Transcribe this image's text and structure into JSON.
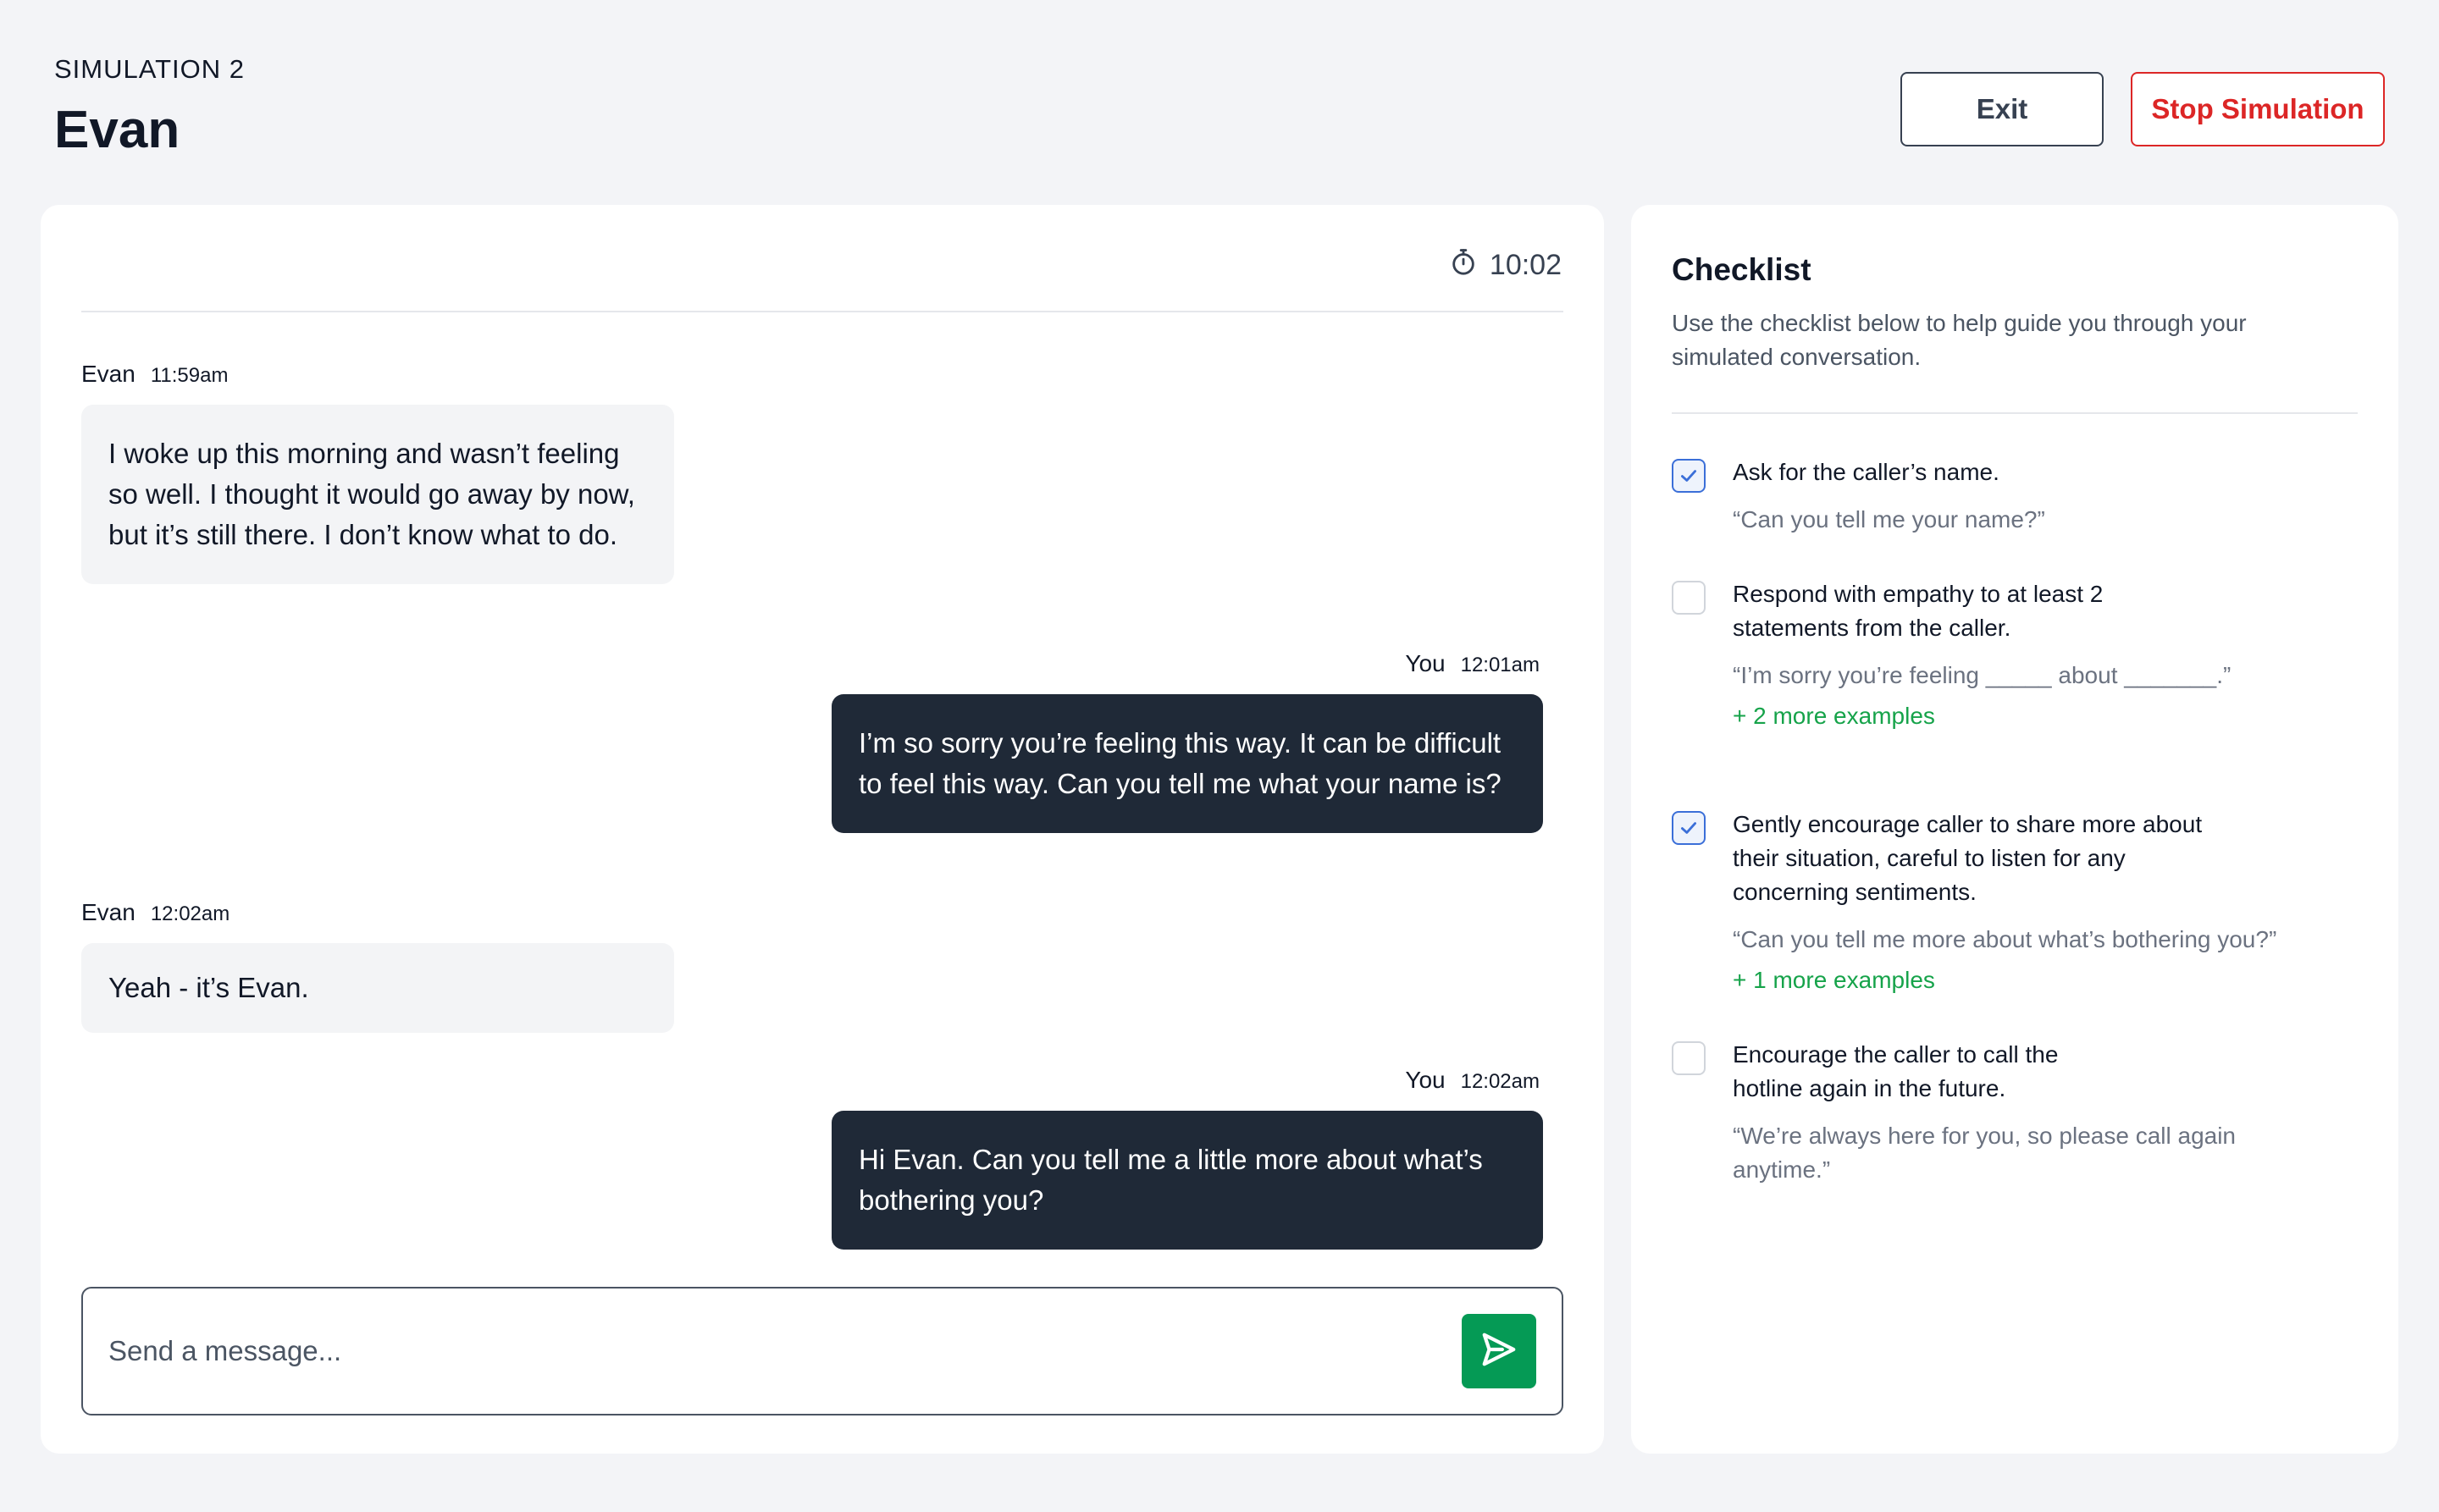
{
  "header": {
    "simulation_label": "SIMULATION 2",
    "caller_name": "Evan",
    "exit_label": "Exit",
    "stop_label": "Stop Simulation"
  },
  "chat": {
    "timer": "10:02",
    "timer_icon": "stopwatch-icon",
    "messages": [
      {
        "sender": "Evan",
        "time": "11:59am",
        "direction": "incoming",
        "text": "I woke up this morning and wasn’t feeling so well. I thought it would go away by now, but it’s still there. I don’t know what to do."
      },
      {
        "sender": "You",
        "time": "12:01am",
        "direction": "outgoing",
        "text": "I’m so sorry you’re feeling this way. It can be difficult to feel this way. Can you tell me what your name is?"
      },
      {
        "sender": "Evan",
        "time": "12:02am",
        "direction": "incoming",
        "text": "Yeah - it’s Evan."
      },
      {
        "sender": "You",
        "time": "12:02am",
        "direction": "outgoing",
        "text": "Hi Evan. Can you tell me a little more about what’s bothering you?"
      }
    ],
    "composer": {
      "placeholder": "Send a message...",
      "value": "",
      "send_icon": "send-icon",
      "send_color": "#059a55"
    }
  },
  "checklist": {
    "title": "Checklist",
    "description": "Use the checklist below to help guide you through your simulated conversation.",
    "items": [
      {
        "checked": true,
        "title": "Ask for the caller’s name.",
        "example": "“Can you tell me your name?”",
        "more": ""
      },
      {
        "checked": false,
        "title": "Respond with empathy to at least 2 statements from the caller.",
        "example": "“I’m sorry you’re feeling _____ about _______.”",
        "more": "+ 2 more examples"
      },
      {
        "checked": true,
        "title": "Gently encourage caller to share more about their situation, careful to listen for any concerning sentiments.",
        "example": "“Can you tell me more about what’s bothering you?”",
        "more": "+ 1 more examples"
      },
      {
        "checked": false,
        "title": "Encourage the caller to call the hotline again in the future.",
        "example": "“We’re always here for you, so please call again anytime.”",
        "more": ""
      }
    ]
  },
  "colors": {
    "background": "#f3f4f7",
    "outgoing_bubble": "#1f2937",
    "incoming_bubble": "#f3f4f6",
    "stop_red": "#dc2626",
    "check_blue": "#3b6fd8",
    "more_green": "#16a34a"
  }
}
